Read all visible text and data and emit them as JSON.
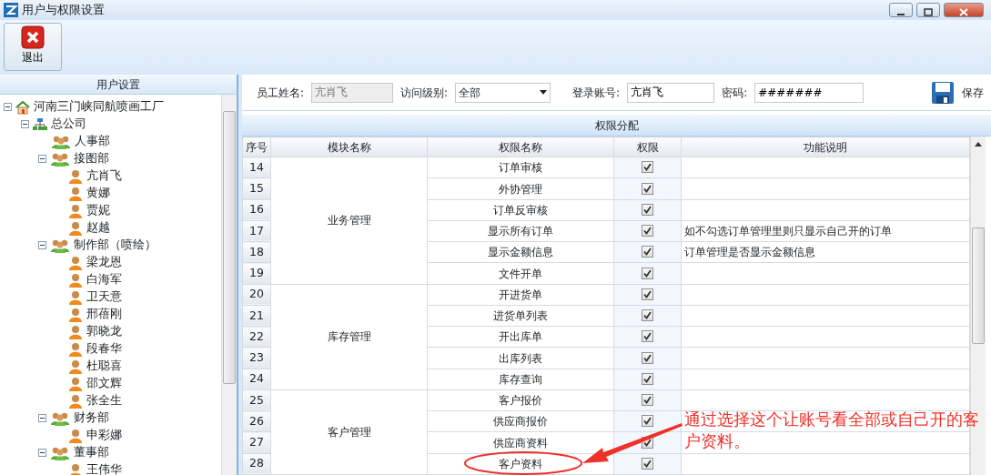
{
  "window": {
    "title": "用户与权限设置"
  },
  "toolbar": {
    "exit_button": "退出"
  },
  "user_panel": {
    "title": "用户设置",
    "tree": [
      {
        "label": "河南三门峡同航喷画工厂",
        "kind": "company",
        "expanded": true,
        "children": [
          {
            "label": "总公司",
            "kind": "org",
            "expanded": true,
            "children": [
              {
                "label": "人事部",
                "kind": "dept"
              },
              {
                "label": "接图部",
                "kind": "dept",
                "expanded": true,
                "children": [
                  {
                    "label": "亢肖飞",
                    "kind": "person"
                  },
                  {
                    "label": "黄娜",
                    "kind": "person"
                  },
                  {
                    "label": "贾妮",
                    "kind": "person"
                  },
                  {
                    "label": "赵越",
                    "kind": "person"
                  }
                ]
              },
              {
                "label": "制作部（喷绘）",
                "kind": "dept",
                "expanded": true,
                "children": [
                  {
                    "label": "梁龙恩",
                    "kind": "person"
                  },
                  {
                    "label": "白海军",
                    "kind": "person"
                  },
                  {
                    "label": "卫天意",
                    "kind": "person"
                  },
                  {
                    "label": "邢蓓刚",
                    "kind": "person"
                  },
                  {
                    "label": "郭晓龙",
                    "kind": "person"
                  },
                  {
                    "label": "段春华",
                    "kind": "person"
                  },
                  {
                    "label": "杜聪喜",
                    "kind": "person"
                  },
                  {
                    "label": "邵文辉",
                    "kind": "person"
                  },
                  {
                    "label": "张全生",
                    "kind": "person"
                  }
                ]
              },
              {
                "label": "财务部",
                "kind": "dept",
                "expanded": true,
                "children": [
                  {
                    "label": "申彩娜",
                    "kind": "person"
                  }
                ]
              },
              {
                "label": "董事部",
                "kind": "dept",
                "expanded": true,
                "children": [
                  {
                    "label": "王伟华",
                    "kind": "person"
                  }
                ]
              }
            ]
          }
        ]
      }
    ]
  },
  "form": {
    "name_label": "员工姓名:",
    "name_value": "亢肖飞",
    "level_label": "访问级别:",
    "level_value": "全部",
    "account_label": "登录账号:",
    "account_value": "亢肖飞",
    "password_label": "密码:",
    "password_value": "#######",
    "save_button": "保存"
  },
  "permissions": {
    "title": "权限分配",
    "columns": [
      "序号",
      "模块名称",
      "权限名称",
      "权限",
      "功能说明"
    ],
    "modules": [
      {
        "name": "业务管理",
        "rows": [
          {
            "no": "14",
            "permission": "订单审核",
            "checked": true
          },
          {
            "no": "15",
            "permission": "外协管理",
            "checked": true
          },
          {
            "no": "16",
            "permission": "订单反审核",
            "checked": true
          },
          {
            "no": "17",
            "permission": "显示所有订单",
            "checked": true,
            "description": "如不勾选订单管理里则只显示自己开的订单"
          },
          {
            "no": "18",
            "permission": "显示金额信息",
            "checked": true,
            "description": "订单管理是否显示金额信息"
          },
          {
            "no": "19",
            "permission": "文件开单",
            "checked": true
          }
        ]
      },
      {
        "name": "库存管理",
        "rows": [
          {
            "no": "20",
            "permission": "开进货单",
            "checked": true
          },
          {
            "no": "21",
            "permission": "进货单列表",
            "checked": true
          },
          {
            "no": "22",
            "permission": "开出库单",
            "checked": true
          },
          {
            "no": "23",
            "permission": "出库列表",
            "checked": true
          },
          {
            "no": "24",
            "permission": "库存查询",
            "checked": true
          }
        ]
      },
      {
        "name": "客户管理",
        "rows": [
          {
            "no": "25",
            "permission": "客户报价",
            "checked": true
          },
          {
            "no": "26",
            "permission": "供应商报价",
            "checked": true
          },
          {
            "no": "27",
            "permission": "供应商资料",
            "checked": true
          },
          {
            "no": "28",
            "permission": "客户资料",
            "checked": true
          }
        ]
      }
    ]
  },
  "annotation": {
    "text": "通过选择这个让账号看全部或自己开的客户资料。"
  }
}
